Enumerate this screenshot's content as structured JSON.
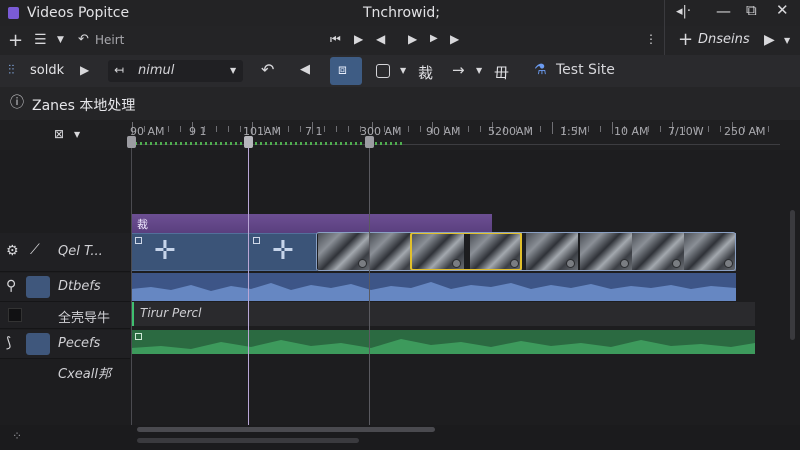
{
  "app": {
    "title": "Videos Popitce",
    "window_title": "Tnchrowid;",
    "accent": "#7a5bd6"
  },
  "titlebar": {
    "right_text": "Dnseins"
  },
  "toolbar1": {
    "back_label": "Heirt"
  },
  "toolbar2": {
    "mode_label": "soldk",
    "dropdown_value": "nimul",
    "glyph_a": "裁",
    "glyph_b": "毌",
    "site_label": "Test Site"
  },
  "project": {
    "title": "Zanes 本地处理"
  },
  "ruler": {
    "labels": [
      "90 AM",
      "9 1",
      "101AM",
      "7 1",
      "300 AM",
      "90 AM",
      "5200AM",
      "1:5M",
      "10 AM",
      "7/10W",
      "250 AM"
    ]
  },
  "tracks": [
    {
      "label": "Qel T...",
      "type": "video"
    },
    {
      "label": "Dtbefs",
      "type": "audio"
    },
    {
      "label": "全壳导牛",
      "type": "title",
      "clip_label": "Tirur Percl"
    },
    {
      "label": "Pecefs",
      "type": "music"
    },
    {
      "label": "Cxeall邦",
      "type": "extra"
    }
  ],
  "overlay_clip": {
    "label": "裁"
  },
  "colors": {
    "video_track": "#3e5a86",
    "audio_track": "#4d6aa3",
    "music_track": "#2f7d4c",
    "purple_clip": "#6a4c8e",
    "selection": "#e2c02b"
  }
}
